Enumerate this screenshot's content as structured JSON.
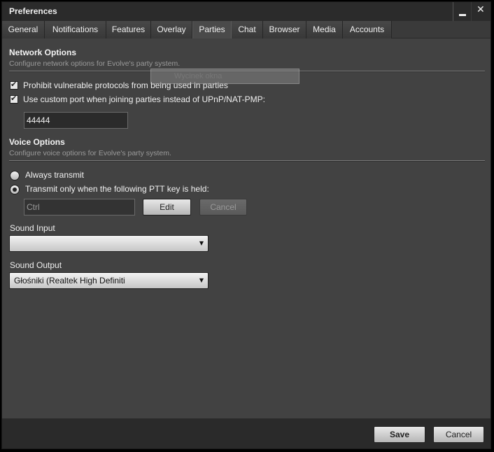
{
  "window": {
    "title": "Preferences",
    "minimize_icon": "minimize-icon",
    "close_icon": "close-icon",
    "close_glyph": "✕"
  },
  "tabs": [
    {
      "label": "General",
      "active": false
    },
    {
      "label": "Notifications",
      "active": false
    },
    {
      "label": "Features",
      "active": false
    },
    {
      "label": "Overlay",
      "active": false
    },
    {
      "label": "Parties",
      "active": true
    },
    {
      "label": "Chat",
      "active": false
    },
    {
      "label": "Browser",
      "active": false
    },
    {
      "label": "Media",
      "active": false
    },
    {
      "label": "Accounts",
      "active": false
    }
  ],
  "network": {
    "title": "Network Options",
    "subtitle": "Configure network options for Evolve's party system.",
    "prohibit_label": "Prohibit vulnerable protocols from being used in parties",
    "prohibit_checked": true,
    "custom_port_label": "Use custom port when joining parties instead of UPnP/NAT-PMP:",
    "custom_port_checked": true,
    "port_value": "44444"
  },
  "overlay_tip": {
    "text": "Wycinek okna"
  },
  "voice": {
    "title": "Voice Options",
    "subtitle": "Configure voice options for Evolve's party system.",
    "always_transmit_label": "Always transmit",
    "always_transmit_selected": false,
    "ptt_label": "Transmit only when the following PTT key is held:",
    "ptt_selected": true,
    "ptt_key_value": "Ctrl",
    "edit_label": "Edit",
    "cancel_label": "Cancel"
  },
  "sound_input": {
    "label": "Sound Input",
    "selected": ""
  },
  "sound_output": {
    "label": "Sound Output",
    "selected": "Głośniki (Realtek High Definiti"
  },
  "footer": {
    "save_label": "Save",
    "cancel_label": "Cancel"
  },
  "icons": {
    "checkbox_check": "check-icon",
    "dropdown_caret": "caret-down-icon",
    "check_glyph": "✔",
    "caret_glyph": "▼"
  },
  "colors": {
    "background": "#424242",
    "titlebar": "#2b2b2b",
    "footer": "#2a2a2a",
    "subtitle_text": "#9a9a9a"
  }
}
